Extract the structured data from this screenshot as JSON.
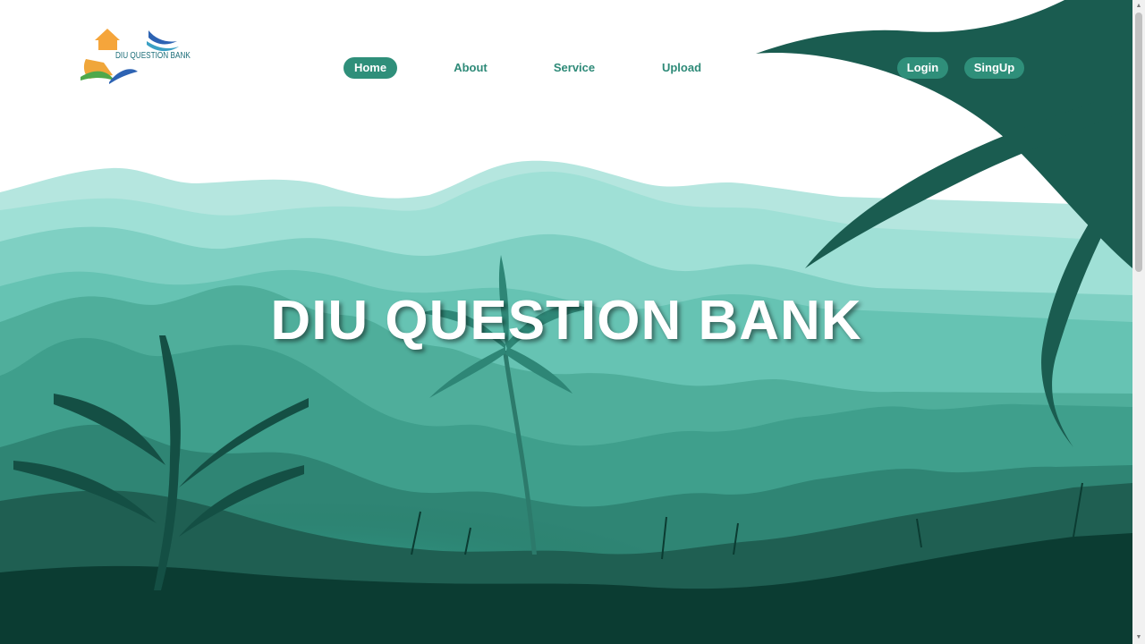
{
  "brand": {
    "logo_text": "DIU QUESTION BANK"
  },
  "nav": {
    "items": [
      {
        "label": "Home",
        "active": true
      },
      {
        "label": "About",
        "active": false
      },
      {
        "label": "Service",
        "active": false
      },
      {
        "label": "Upload",
        "active": false
      }
    ]
  },
  "auth": {
    "login_label": "Login",
    "signup_label": "SingUp"
  },
  "hero": {
    "title": "DIU QUESTION BANK"
  },
  "colors": {
    "accent": "#2f8f7a",
    "sky_mountain_far": "#b5e6df",
    "mountain_mid": "#8fd9cf",
    "forest_mid": "#3f9f8c",
    "forest_dark": "#1f5f52",
    "ground": "#0b3c32"
  }
}
